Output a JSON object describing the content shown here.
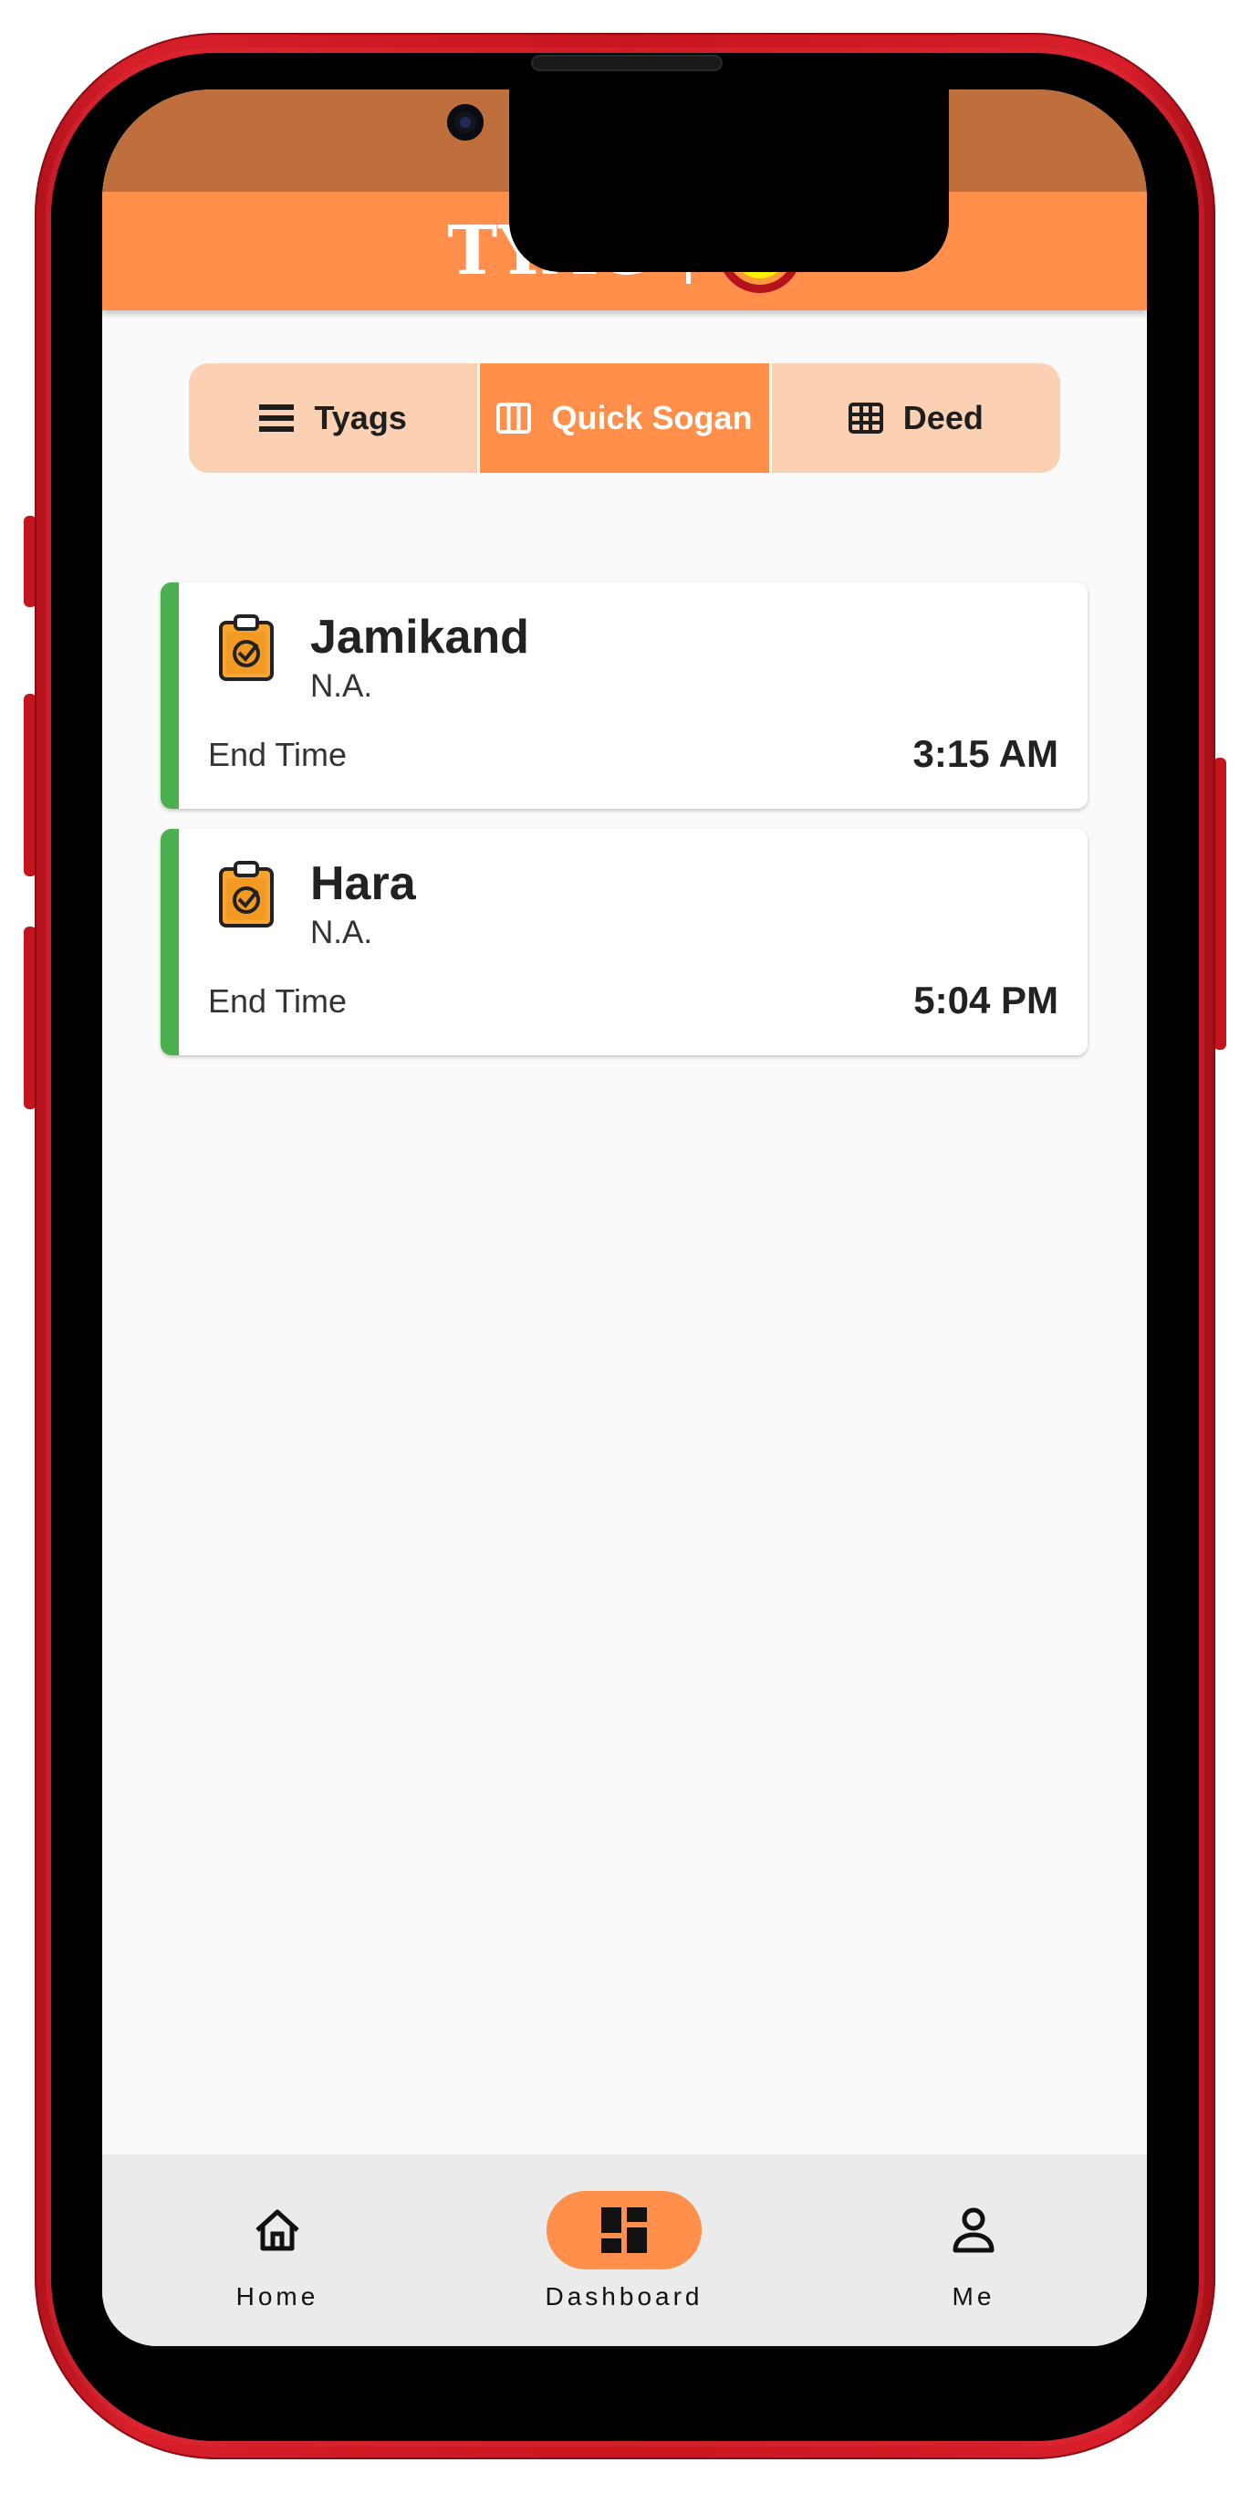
{
  "header": {
    "brand": "TYAG"
  },
  "tabs": [
    {
      "label": "Tyags",
      "icon": "list-icon",
      "active": false
    },
    {
      "label": "Quick Sogan",
      "icon": "columns-icon",
      "active": true
    },
    {
      "label": "Deed",
      "icon": "grid-icon",
      "active": false
    }
  ],
  "cards": [
    {
      "title": "Jamikand",
      "subtitle": "N.A.",
      "end_label": "End Time",
      "end_value": "3:15 AM",
      "icon": "clipboard-check-icon"
    },
    {
      "title": "Hara",
      "subtitle": "N.A.",
      "end_label": "End Time",
      "end_value": "5:04 PM",
      "icon": "clipboard-check-icon"
    }
  ],
  "bottom_nav": [
    {
      "label": "Home",
      "icon": "home-icon",
      "active": false
    },
    {
      "label": "Dashboard",
      "icon": "dashboard-icon",
      "active": true
    },
    {
      "label": "Me",
      "icon": "person-icon",
      "active": false
    }
  ],
  "colors": {
    "primary": "#ff8f4a",
    "status_bar": "#be6f3c",
    "tab_inactive": "#fbd0b3",
    "card_accent": "#4caf50",
    "device_frame": "#c8161f"
  }
}
